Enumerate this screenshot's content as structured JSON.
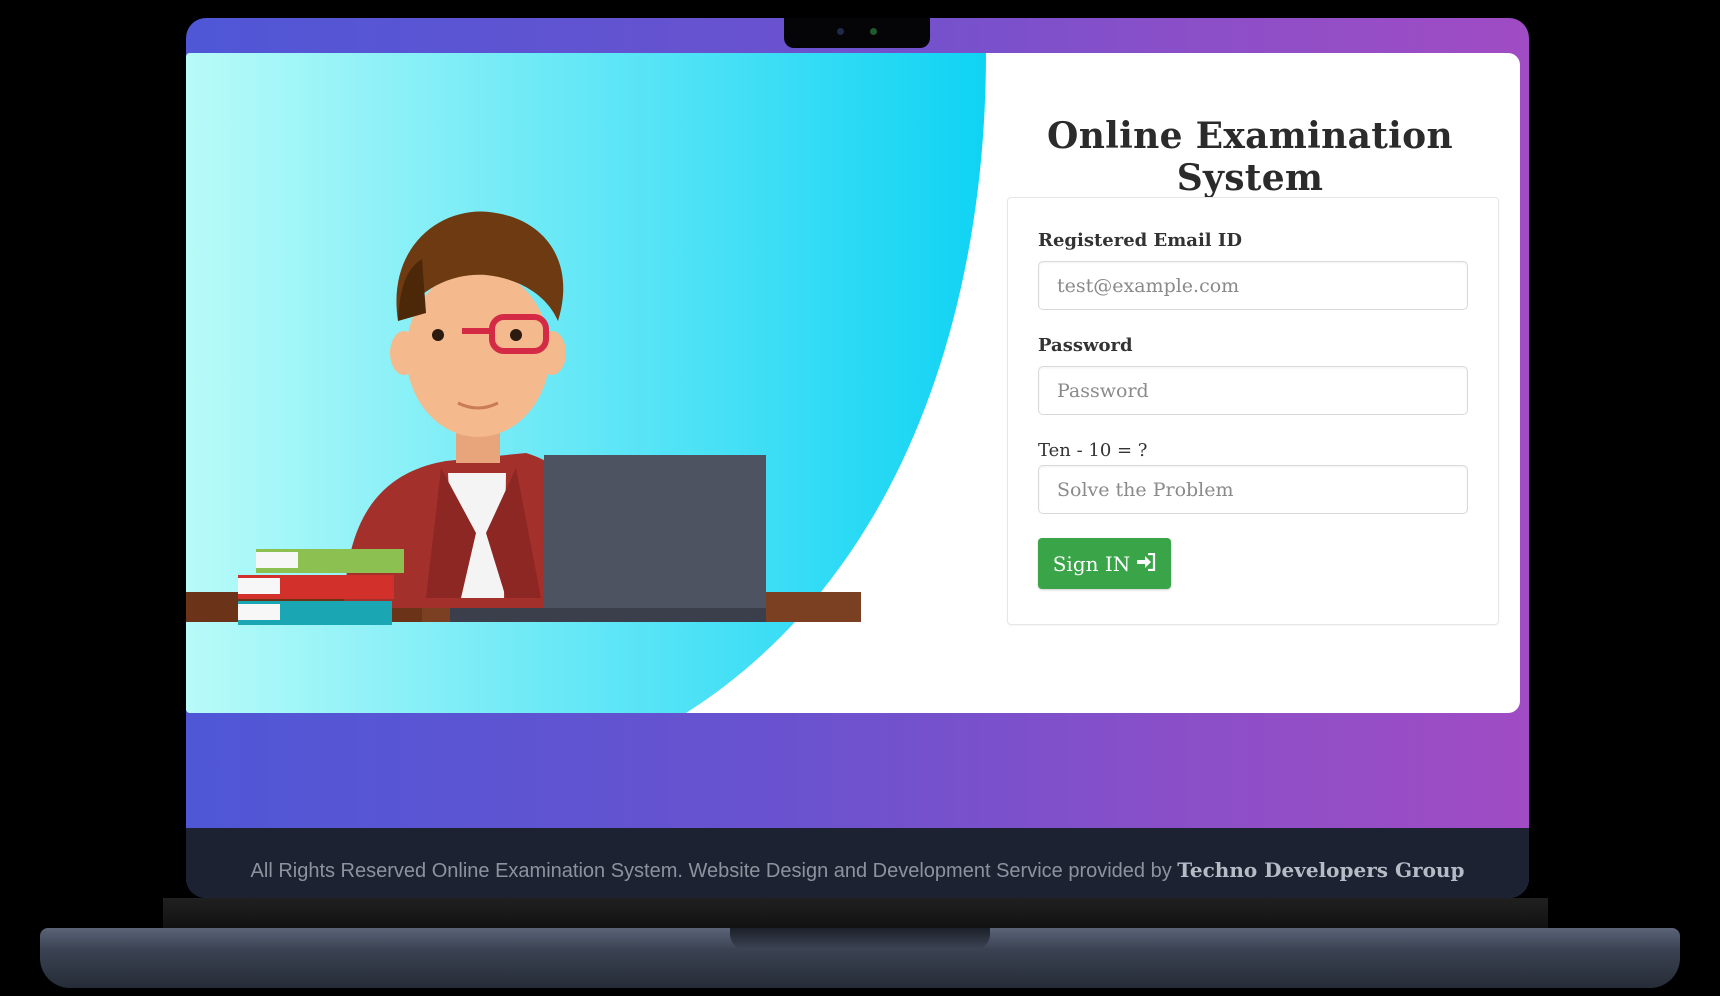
{
  "app": {
    "title": "Online Examination System"
  },
  "login_form": {
    "email_label": "Registered Email ID",
    "email_placeholder": "test@example.com",
    "email_value": "",
    "password_label": "Password",
    "password_placeholder": "Password",
    "password_value": "",
    "captcha_label": "Ten - 10 = ?",
    "captcha_placeholder": "Solve the Problem",
    "captcha_value": "",
    "signin_label": "Sign IN",
    "signin_icon": "sign-in-icon"
  },
  "footer": {
    "text": "All Rights Reserved Online Examination System. Website Design and Development Service provided by",
    "brand": "Techno Developers Group"
  },
  "colors": {
    "signin_button": "#3aa548",
    "hero_gradient_start": "#b8fbf8",
    "hero_gradient_end": "#0fd3f4",
    "frame_gradient_start": "#4f57d6",
    "frame_gradient_end": "#a04cc4",
    "footer_background": "#1c2231"
  }
}
